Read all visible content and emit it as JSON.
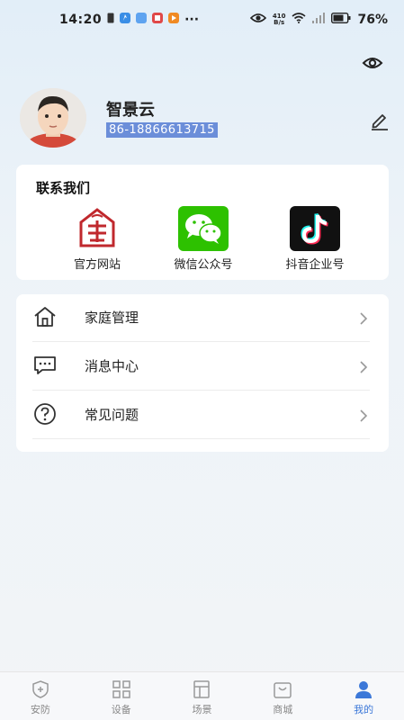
{
  "status_bar": {
    "time": "14:20",
    "net_speed_value": "410",
    "net_speed_unit": "B/s",
    "battery": "76%"
  },
  "profile": {
    "name": "智景云",
    "phone": "86-18866613715"
  },
  "contact": {
    "title": "联系我们",
    "items": [
      {
        "label": "官方网站",
        "icon": "website-logo-icon"
      },
      {
        "label": "微信公众号",
        "icon": "wechat-icon"
      },
      {
        "label": "抖音企业号",
        "icon": "douyin-icon"
      }
    ]
  },
  "menu": {
    "items": [
      {
        "label": "家庭管理",
        "icon": "home-icon"
      },
      {
        "label": "消息中心",
        "icon": "message-icon"
      },
      {
        "label": "常见问题",
        "icon": "question-icon"
      }
    ]
  },
  "tabs": [
    {
      "label": "安防",
      "icon": "shield-icon"
    },
    {
      "label": "设备",
      "icon": "grid-icon"
    },
    {
      "label": "场景",
      "icon": "scene-icon"
    },
    {
      "label": "商城",
      "icon": "shop-icon"
    },
    {
      "label": "我的",
      "icon": "user-icon",
      "active": true
    }
  ],
  "colors": {
    "accent": "#3c78d8",
    "wechat_green": "#2dc100",
    "douyin_black": "#111111",
    "brand_red": "#c0282d"
  }
}
